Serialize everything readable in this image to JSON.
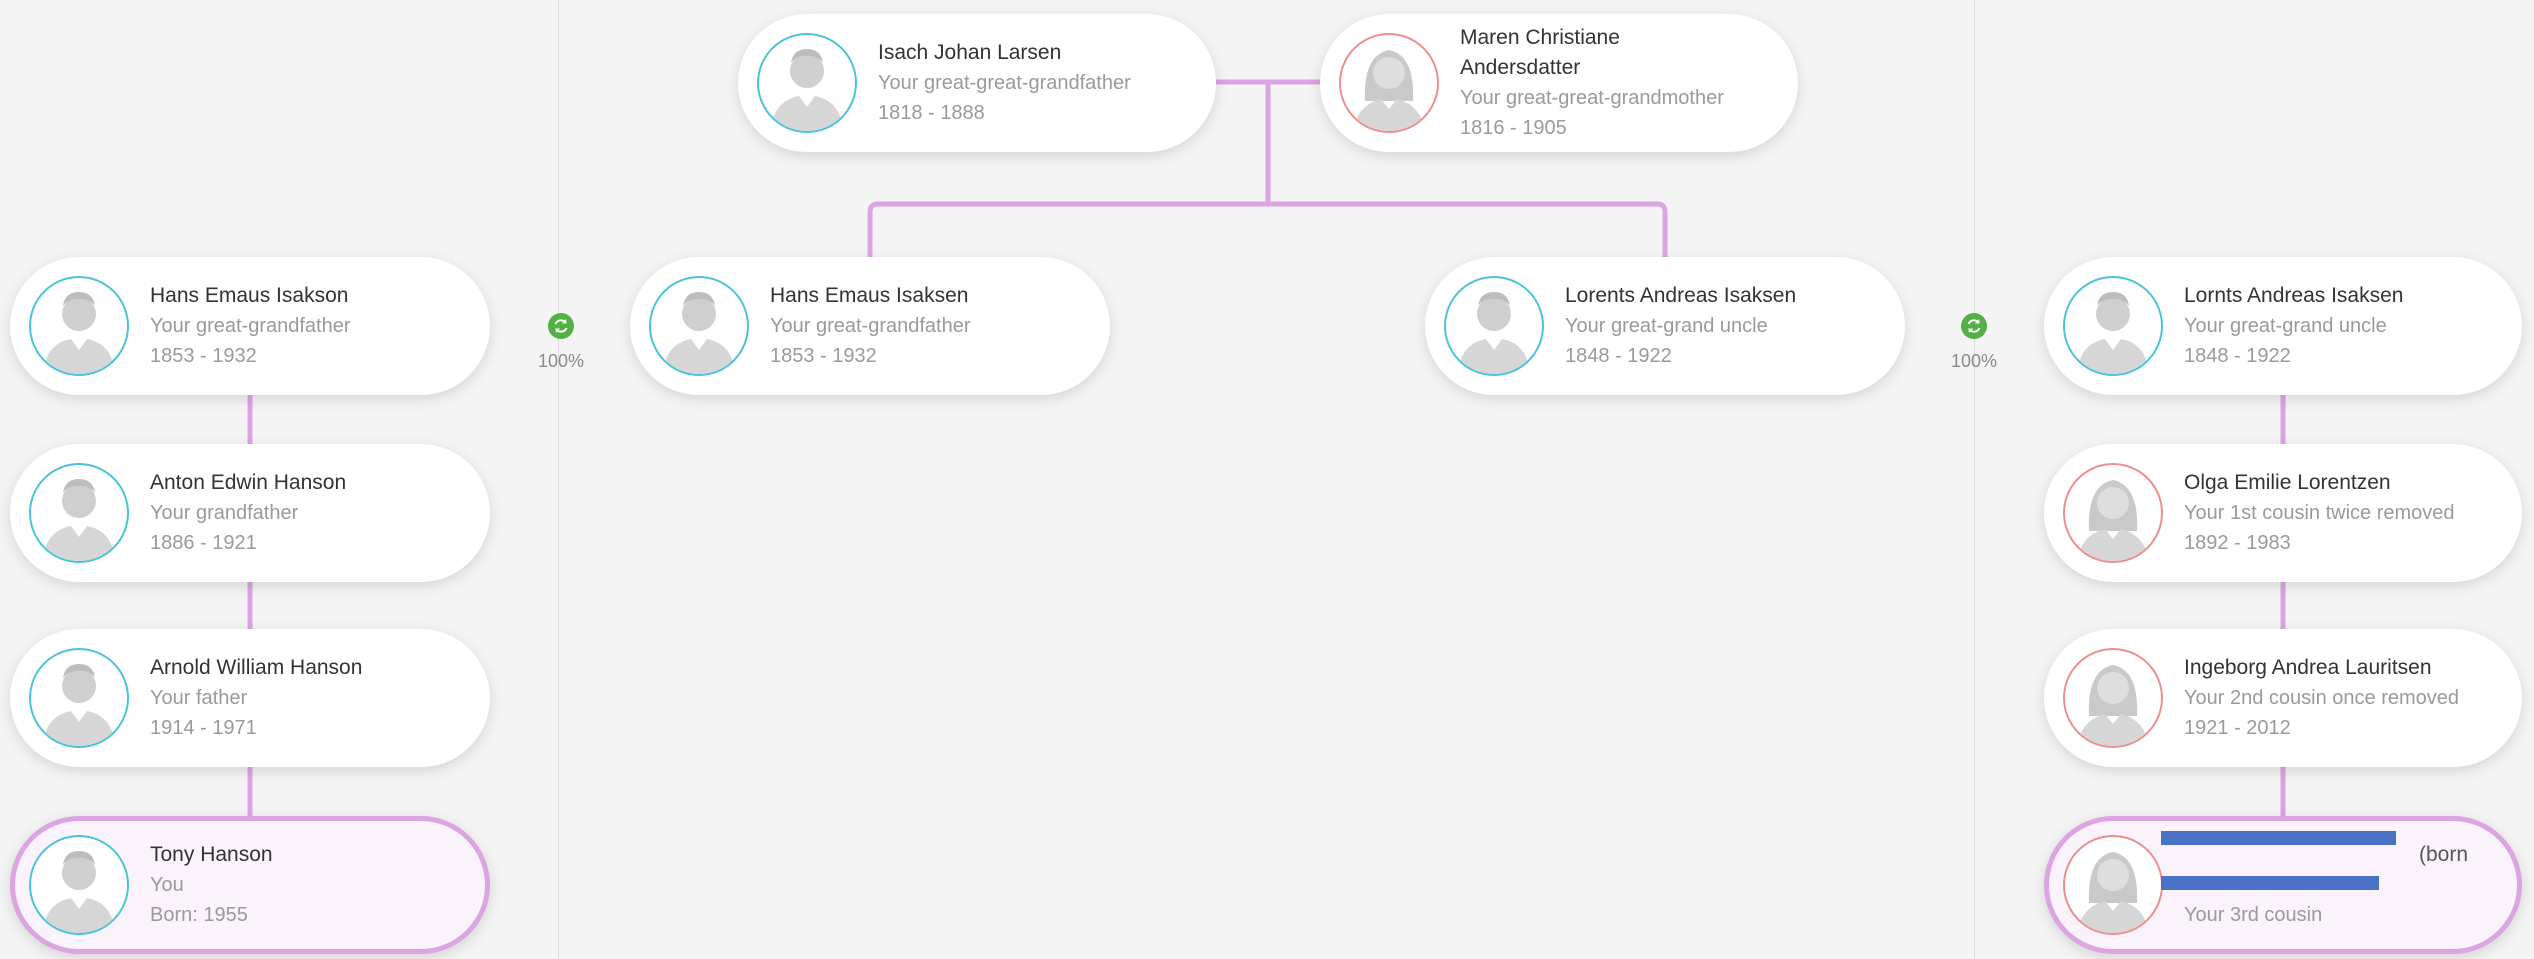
{
  "ancestors": {
    "father": {
      "name": "Isach Johan Larsen",
      "relation": "Your great-great-grandfather",
      "years": "1818 - 1888"
    },
    "mother": {
      "name": "Maren Christiane Andersdatter",
      "relation": "Your great-great-grandmother",
      "years": "1816 - 1905"
    }
  },
  "left_column": [
    {
      "name": "Hans Emaus Isakson",
      "relation": "Your great-grandfather",
      "years": "1853 - 1932"
    },
    {
      "name": "Anton Edwin Hanson",
      "relation": "Your grandfather",
      "years": "1886 - 1921"
    },
    {
      "name": "Arnold William Hanson",
      "relation": "Your father",
      "years": "1914 - 1971"
    },
    {
      "name": "Tony Hanson",
      "relation": "You",
      "years": "Born: 1955"
    }
  ],
  "center": {
    "left": {
      "name": "Hans Emaus Isaksen",
      "relation": "Your great-grandfather",
      "years": "1853 - 1932"
    },
    "right": {
      "name": "Lorents Andreas Isaksen",
      "relation": "Your great-grand uncle",
      "years": "1848 - 1922"
    }
  },
  "right_column": [
    {
      "name": "Lornts Andreas Isaksen",
      "relation": "Your great-grand uncle",
      "years": "1848 - 1922"
    },
    {
      "name": "Olga Emilie Lorentzen",
      "relation": "Your 1st cousin twice removed",
      "years": "1892 - 1983"
    },
    {
      "name": "Ingeborg Andrea Lauritsen",
      "relation": "Your 2nd cousin once removed",
      "years": "1921 - 2012"
    },
    {
      "name": "(born",
      "relation": "Your 3rd cousin"
    }
  ],
  "matches": {
    "left_percent": "100%",
    "right_percent": "100%"
  },
  "colors": {
    "connector": "#dca4e2",
    "male_ring": "#4cc3d6",
    "female_ring": "#ee8f8f",
    "match_icon": "#52b044",
    "redaction": "#4a72c4"
  }
}
